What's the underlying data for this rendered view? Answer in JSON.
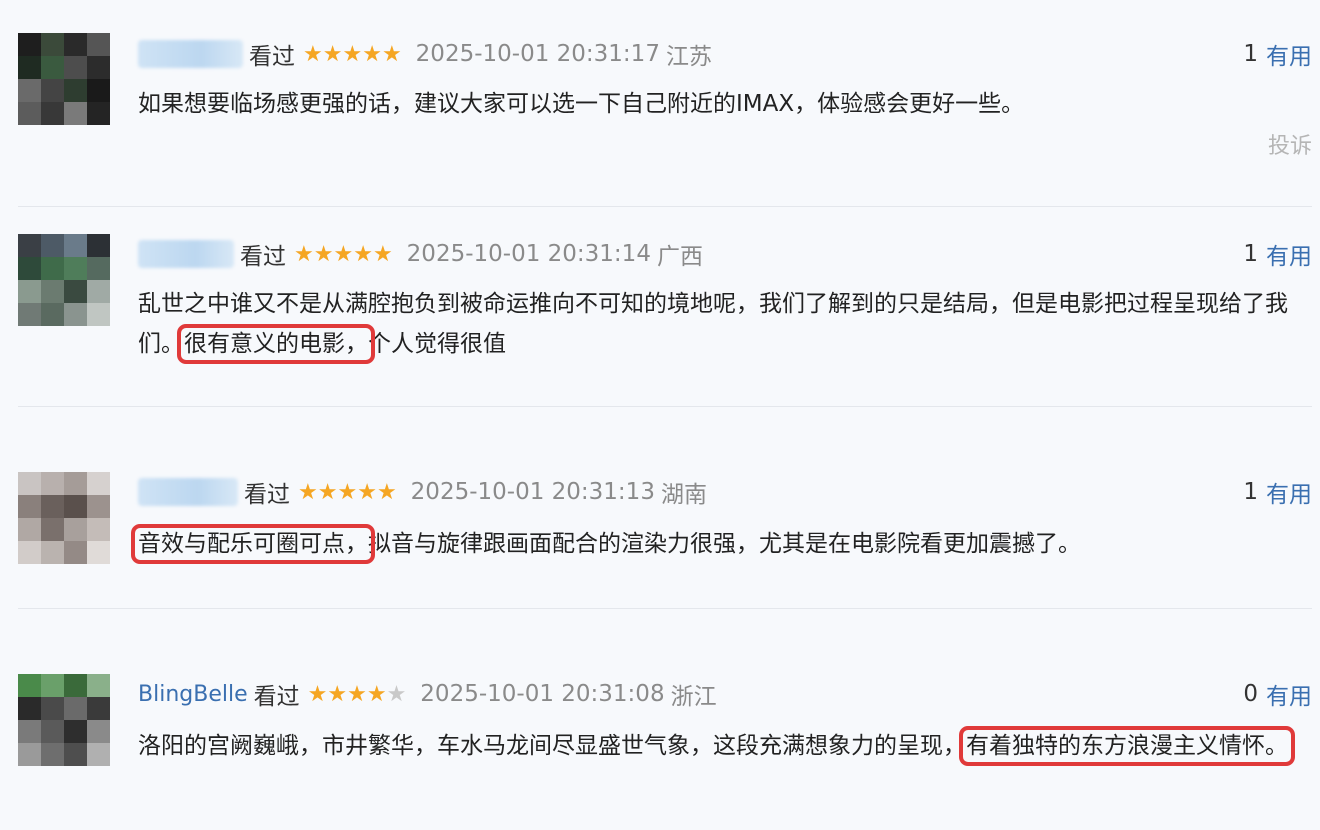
{
  "comments": [
    {
      "user": "",
      "watched": "看过",
      "rating": 5,
      "date": "2025-10-01 20:31:17",
      "region": "江苏",
      "useful_count": "1",
      "useful_label": "有用",
      "text_segments": [
        {
          "text": "如果想要临场感更强的话，建议大家可以选一下自己附近的IMAX，体验感会更好一些。",
          "highlight": false
        }
      ],
      "report_label": "投诉"
    },
    {
      "user": "",
      "watched": "看过",
      "rating": 5,
      "date": "2025-10-01 20:31:14",
      "region": "广西",
      "useful_count": "1",
      "useful_label": "有用",
      "text_segments": [
        {
          "text": "乱世之中谁又不是从满腔抱负到被命运推向不可知的境地呢，我们了解到的只是结局，但是电影把过程呈现给了我们。",
          "highlight": false
        },
        {
          "text": "很有意义的电影，",
          "highlight": true
        },
        {
          "text": "个人觉得很值",
          "highlight": false
        }
      ]
    },
    {
      "user": "",
      "watched": "看过",
      "rating": 5,
      "date": "2025-10-01 20:31:13",
      "region": "湖南",
      "useful_count": "1",
      "useful_label": "有用",
      "text_segments": [
        {
          "text": "音效与配乐可圈可点，",
          "highlight": true
        },
        {
          "text": "拟音与旋律跟画面配合的渲染力很强，尤其是在电影院看更加震撼了。",
          "highlight": false
        }
      ]
    },
    {
      "user": "BlingBelle",
      "watched": "看过",
      "rating": 4,
      "date": "2025-10-01 20:31:08",
      "region": "浙江",
      "useful_count": "0",
      "useful_label": "有用",
      "text_segments": [
        {
          "text": "洛阳的宫阙巍峨，市井繁华，车水马龙间尽显盛世气象，这段充满想象力的呈现，",
          "highlight": false
        },
        {
          "text": "有着独特的东方浪漫主义情怀。",
          "highlight": true
        }
      ]
    }
  ],
  "colors": {
    "star": "#f5a623",
    "link": "#3a6fb0",
    "highlight_box": "#e03a3a"
  }
}
